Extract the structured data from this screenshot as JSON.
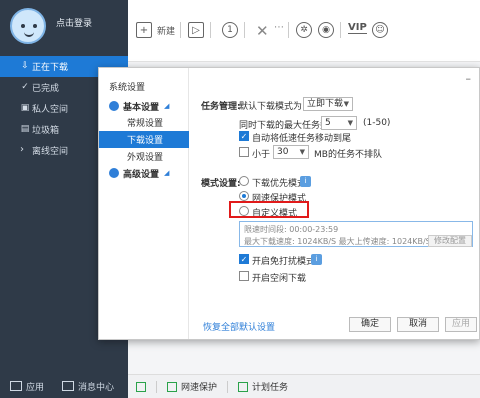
{
  "sidebar": {
    "login": "点击登录",
    "items": [
      {
        "label": "正在下载",
        "icon": "download-icon"
      },
      {
        "label": "已完成",
        "icon": "check-circle-icon"
      },
      {
        "label": "私人空间",
        "icon": "lock-icon"
      },
      {
        "label": "垃圾箱",
        "icon": "trash-icon"
      },
      {
        "label": "离线空间",
        "icon": "chevron-right-icon"
      }
    ],
    "apps": "应用",
    "messages": "消息中心"
  },
  "toolbar": {
    "new_label": "新建",
    "vip": "VIP"
  },
  "statusbar": {
    "protect": "网速保护",
    "plan": "计划任务"
  },
  "dialog": {
    "title": "系统设置",
    "tree": {
      "basic": "基本设置",
      "common": "常规设置",
      "download": "下载设置",
      "appearance": "外观设置",
      "advanced": "高级设置"
    },
    "task": {
      "section": "任务管理:",
      "default_mode_label": "默认下载模式为",
      "default_mode_value": "立即下载",
      "max_tasks_label": "同时下载的最大任务数",
      "max_tasks_value": "5",
      "max_tasks_range": "(1-50)",
      "auto_move": "自动将低速任务移动到尾",
      "less_than": "小于",
      "less_value": "30",
      "less_suffix": "MB的任务不排队"
    },
    "mode": {
      "section": "模式设置:",
      "priority": "下载优先模式",
      "protect": "网速保护模式",
      "custom": "自定义模式",
      "limit_time": "限速时间段: 00:00-23:59",
      "limit_speed": "最大下载速度: 1024KB/S   最大上传速度: 1024KB/S",
      "edit": "修改配置",
      "no_disturb": "开启免打扰模式",
      "idle": "开启空闲下载"
    },
    "restore": "恢复全部默认设置",
    "ok": "确定",
    "cancel": "取消",
    "apply": "应用"
  }
}
